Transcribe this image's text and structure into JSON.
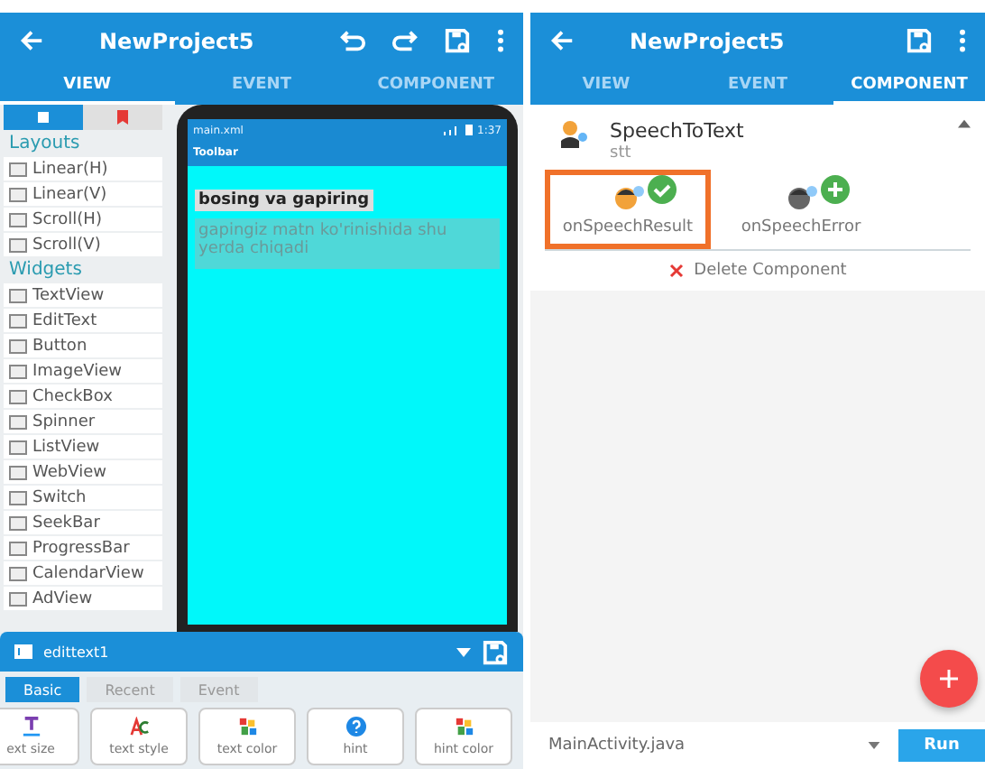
{
  "left": {
    "title": "NewProject5",
    "tabs": [
      {
        "label": "VIEW",
        "selected": true
      },
      {
        "label": "EVENT",
        "selected": false
      },
      {
        "label": "COMPONENT",
        "selected": false
      }
    ],
    "palette_tabs": [
      {
        "kind": "widgets",
        "selected": true
      },
      {
        "kind": "bookmark",
        "selected": false
      }
    ],
    "sections": [
      {
        "heading": "Layouts",
        "items": [
          "Linear(H)",
          "Linear(V)",
          "Scroll(H)",
          "Scroll(V)"
        ]
      },
      {
        "heading": "Widgets",
        "items": [
          "TextView",
          "EditText",
          "Button",
          "ImageView",
          "CheckBox",
          "Spinner",
          "ListView",
          "WebView",
          "Switch",
          "SeekBar",
          "ProgressBar",
          "CalendarView",
          "AdView"
        ]
      }
    ],
    "phone": {
      "file": "main.xml",
      "time": "1:37",
      "toolbar": "Toolbar",
      "label": "bosing va gapiring",
      "placeholder": "gapingiz matn ko'rinishida shu yerda chiqadi"
    },
    "properties_bar": {
      "widget": "edittext1",
      "tabs": [
        {
          "label": "Basic",
          "selected": true
        },
        {
          "label": "Recent",
          "selected": false
        },
        {
          "label": "Event",
          "selected": false
        }
      ],
      "properties": [
        {
          "kind": "size",
          "label": "ext size"
        },
        {
          "kind": "style",
          "label": "text style"
        },
        {
          "kind": "color",
          "label": "text color"
        },
        {
          "kind": "hint",
          "label": "hint"
        },
        {
          "kind": "color",
          "label": "hint color"
        }
      ]
    }
  },
  "right": {
    "title": "NewProject5",
    "tabs": [
      {
        "label": "VIEW",
        "selected": false
      },
      {
        "label": "EVENT",
        "selected": false
      },
      {
        "label": "COMPONENT",
        "selected": true
      }
    ],
    "component": {
      "name": "SpeechToText",
      "id": "stt",
      "expanded": true,
      "events": [
        {
          "label": "onSpeechResult",
          "selected": true,
          "added": true
        },
        {
          "label": "onSpeechError",
          "selected": false,
          "added": false
        }
      ],
      "delete": "Delete Component"
    },
    "file": "MainActivity.java",
    "run": "Run"
  }
}
